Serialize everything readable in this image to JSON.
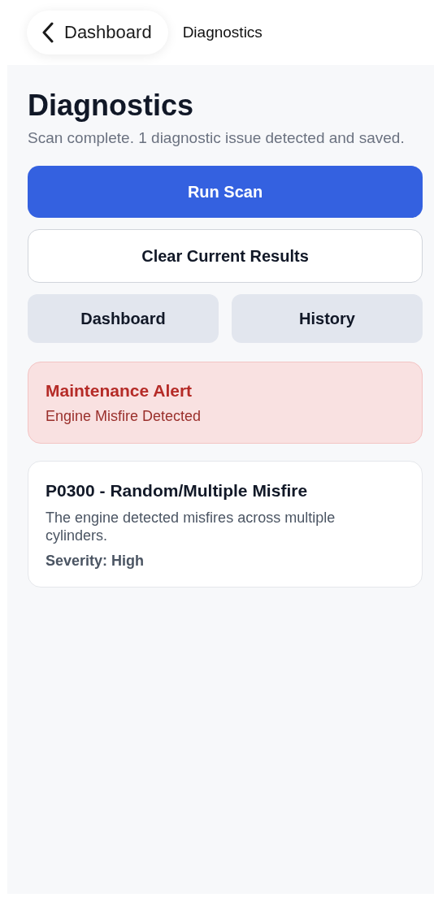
{
  "nav": {
    "back_label": "Dashboard",
    "title": "Diagnostics"
  },
  "header": {
    "title": "Diagnostics",
    "subtitle": "Scan complete. 1 diagnostic issue detected and saved."
  },
  "actions": [
    {
      "label": "Run Scan",
      "kind": "primary"
    },
    {
      "label": "Clear Current Results",
      "kind": "outline"
    }
  ],
  "links": [
    {
      "label": "Dashboard"
    },
    {
      "label": "History"
    }
  ],
  "alert": {
    "title": "Maintenance Alert",
    "message": "Engine Misfire Detected"
  },
  "issues": [
    {
      "title": "P0300 - Random/Multiple Misfire",
      "description": "The engine detected misfires across multiple cylinders.",
      "severity": "Severity: High"
    }
  ]
}
